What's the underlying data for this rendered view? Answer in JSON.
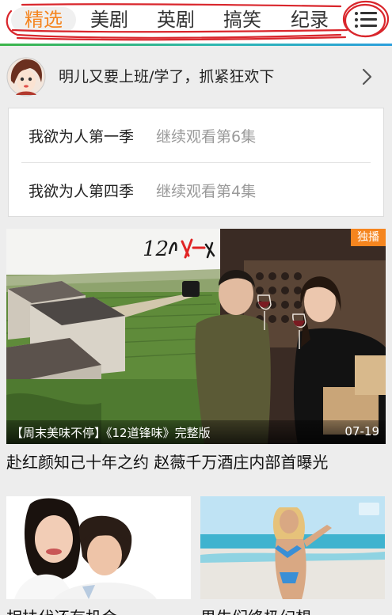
{
  "tabs": [
    {
      "label": "精选",
      "active": true
    },
    {
      "label": "美剧",
      "active": false
    },
    {
      "label": "英剧",
      "active": false
    },
    {
      "label": "搞笑",
      "active": false
    },
    {
      "label": "纪录",
      "active": false
    }
  ],
  "menu": {
    "icon": "list-menu-icon"
  },
  "accent_colors": {
    "active_tab": "#f5851f",
    "scribble": "#d9262c",
    "badge": "#f5851f"
  },
  "notification": {
    "text": "明儿又要上班/学了，抓紧狂欢下",
    "icon": "chevron-right-icon"
  },
  "history": [
    {
      "title": "我欲为人第一季",
      "progress": "继续观看第6集"
    },
    {
      "title": "我欲为人第四季",
      "progress": "继续观看第4集"
    }
  ],
  "featured": {
    "badge": "独播",
    "caption": "【周末美味不停】《12道锋味》完整版",
    "date": "07-19",
    "title": "赴红颜知己十年之约 赵薇千万酒庄内部首曝光"
  },
  "grid": [
    {
      "title": "相扶代还有机会"
    },
    {
      "title": "男生们终极幻想"
    }
  ]
}
